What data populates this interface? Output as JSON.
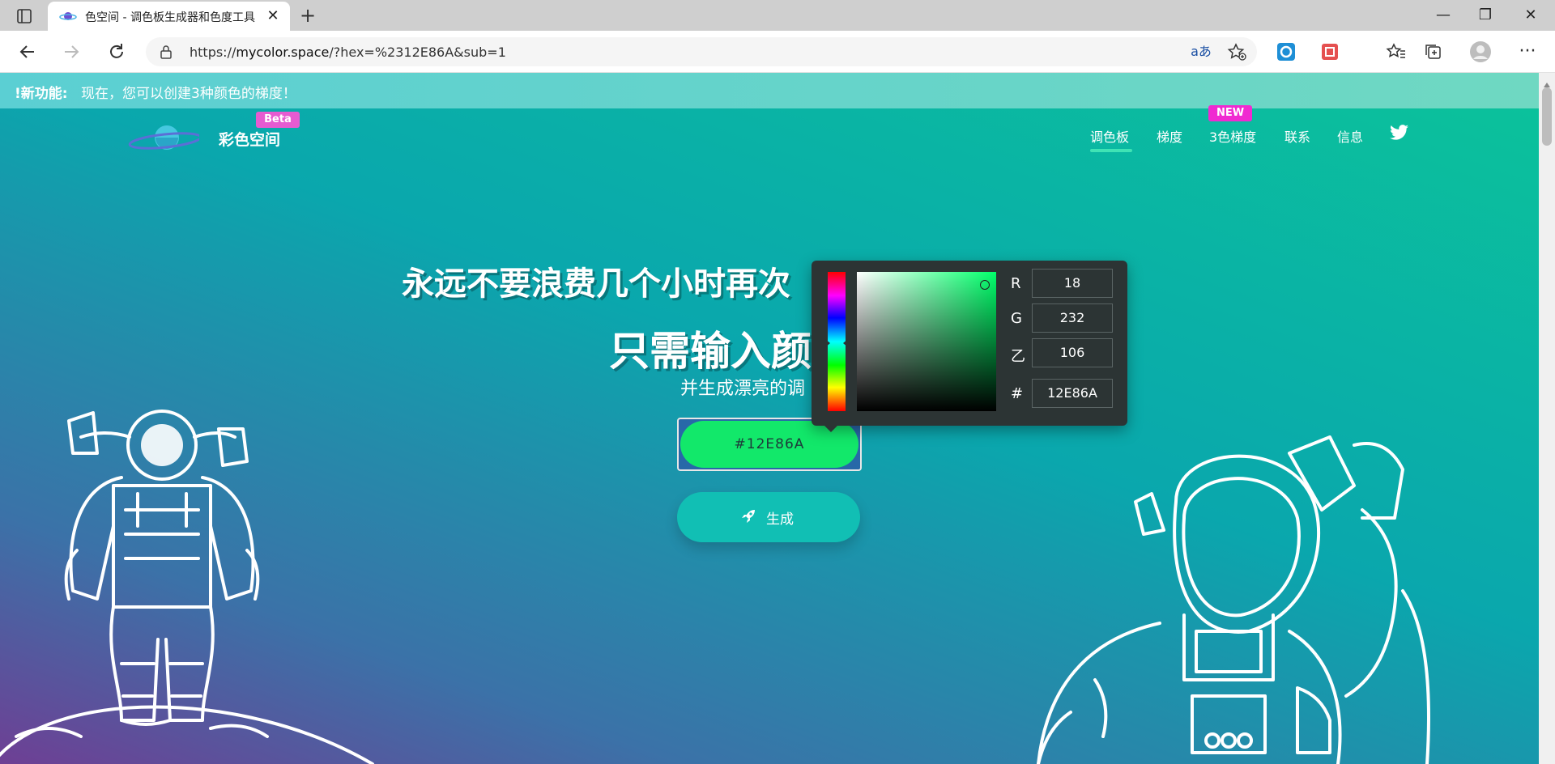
{
  "browser": {
    "tab_title": "色空间 - 调色板生成器和色度工具",
    "tab_close": "✕",
    "new_tab": "+",
    "url_prefix": "https://",
    "url_domain": "mycolor.space",
    "url_rest": "/?hex=%2312E86A&sub=1",
    "read_aloud": "aあ",
    "minimize": "—",
    "maximize": "❐",
    "close": "✕",
    "more": "···"
  },
  "announcement": {
    "label": "!新功能:",
    "text": "现在，您可以创建3种颜色的梯度！"
  },
  "header": {
    "brand": "彩色空间",
    "beta": "Beta",
    "nav": [
      {
        "label": "调色板"
      },
      {
        "label": "梯度"
      },
      {
        "label": "3色梯度"
      },
      {
        "label": "联系"
      },
      {
        "label": "信息"
      }
    ],
    "new_badge": "NEW"
  },
  "hero": {
    "line1": "永远不要浪费几个小时再次",
    "line2": "只需输入颜",
    "line3": "并生成漂亮的调"
  },
  "color_input": {
    "value": "#12E86A"
  },
  "generate_button": {
    "label": "生成"
  },
  "picker": {
    "r_label": "R",
    "g_label": "G",
    "b_label": "乙",
    "hex_label": "#",
    "r": "18",
    "g": "232",
    "b": "106",
    "hex": "12E86A"
  },
  "colors": {
    "accent": "#12E86A",
    "button": "#11BFB4",
    "beta_badge": "#E65BD1",
    "new_badge": "#F02AD1"
  }
}
